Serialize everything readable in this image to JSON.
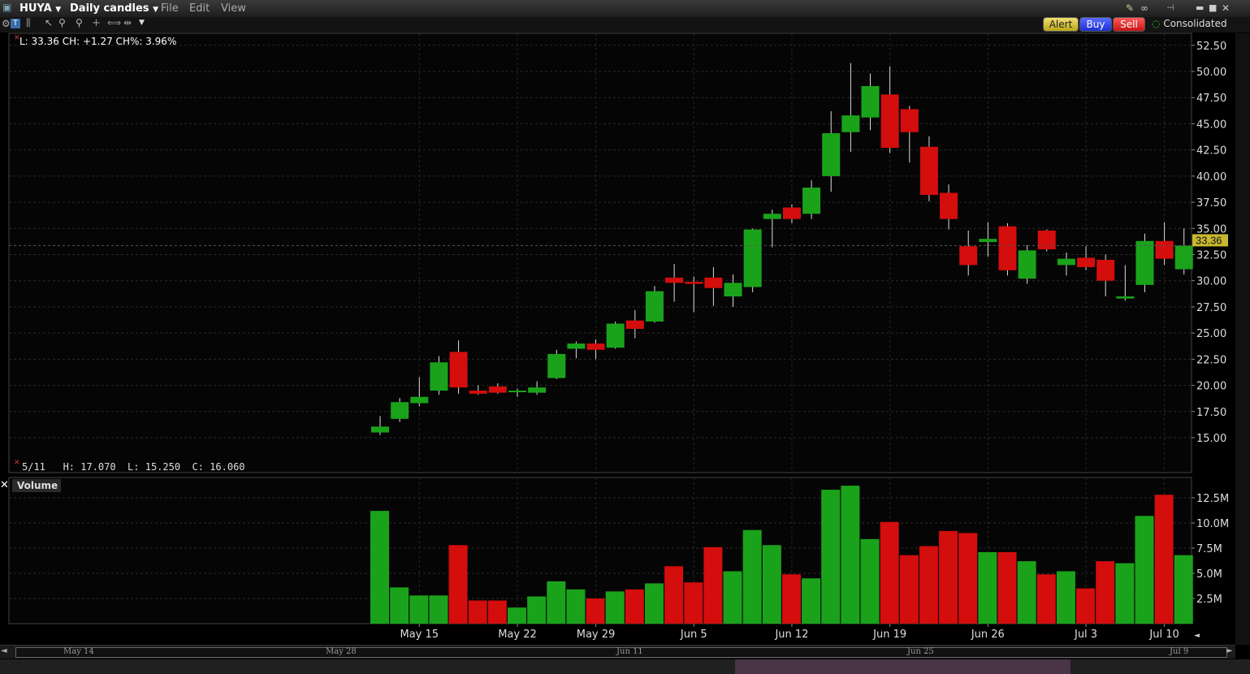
{
  "window": {
    "symbol": "HUYA",
    "chart_type": "Daily candles",
    "menu": [
      "File",
      "Edit",
      "View"
    ],
    "alert_label": "Alert",
    "buy_label": "Buy",
    "sell_label": "Sell",
    "consolidated_label": "Consolidated"
  },
  "info": {
    "top_line": "L: 33.36 CH: +1.27 CH%: 3.96%",
    "bottom_line": "5/11   H: 17.070  L: 15.250  C: 16.060",
    "last_price_badge": "33.36"
  },
  "volume_label": "Volume",
  "colors": {
    "up": "#1aa31a",
    "down": "#d40d0d",
    "badge": "#c8b830",
    "background": "#000000"
  },
  "scroll_labels": [
    "May 14",
    "May 28",
    "Jun 11",
    "Jun 25",
    "Jul 9"
  ],
  "chart_data": {
    "type": "candlestick",
    "price_ticks": [
      15.0,
      17.5,
      20.0,
      22.5,
      25.0,
      27.5,
      30.0,
      32.5,
      35.0,
      37.5,
      40.0,
      42.5,
      45.0,
      47.5,
      50.0,
      52.5
    ],
    "price_tick_labels": [
      "15.00",
      "17.50",
      "20.00",
      "22.50",
      "25.00",
      "27.50",
      "30.00",
      "32.50",
      "35.00",
      "37.50",
      "40.00",
      "42.50",
      "45.00",
      "47.50",
      "50.00",
      "52.50"
    ],
    "volume_ticks": [
      2.5,
      5.0,
      7.5,
      10.0,
      12.5
    ],
    "volume_tick_labels": [
      "2.5M",
      "5.0M",
      "7.5M",
      "10.0M",
      "12.5M"
    ],
    "x_labels": [
      "May 15",
      "May 22",
      "May 29",
      "Jun 5",
      "Jun 12",
      "Jun 19",
      "Jun 26",
      "Jul 3",
      "Jul 10"
    ],
    "x_label_dates": [
      "5/15",
      "5/22",
      "5/29",
      "6/5",
      "6/12",
      "6/19",
      "6/26",
      "7/3",
      "7/10"
    ],
    "candles": [
      {
        "d": "5/11",
        "o": 15.5,
        "h": 17.07,
        "l": 15.25,
        "c": 16.06,
        "v": 11.2
      },
      {
        "d": "5/14",
        "o": 16.8,
        "h": 18.8,
        "l": 16.5,
        "c": 18.4,
        "v": 3.6
      },
      {
        "d": "5/15",
        "o": 18.3,
        "h": 20.8,
        "l": 18.0,
        "c": 18.9,
        "v": 2.8
      },
      {
        "d": "5/16",
        "o": 19.5,
        "h": 22.8,
        "l": 19.1,
        "c": 22.2,
        "v": 2.8
      },
      {
        "d": "5/17",
        "o": 23.2,
        "h": 24.3,
        "l": 19.2,
        "c": 19.8,
        "v": 7.8
      },
      {
        "d": "5/18",
        "o": 19.5,
        "h": 20.0,
        "l": 19.1,
        "c": 19.2,
        "v": 2.3
      },
      {
        "d": "5/21",
        "o": 19.9,
        "h": 20.2,
        "l": 19.2,
        "c": 19.3,
        "v": 2.3
      },
      {
        "d": "5/22",
        "o": 19.4,
        "h": 19.7,
        "l": 18.9,
        "c": 19.5,
        "v": 1.6
      },
      {
        "d": "5/23",
        "o": 19.3,
        "h": 20.4,
        "l": 19.1,
        "c": 19.8,
        "v": 2.7
      },
      {
        "d": "5/24",
        "o": 20.7,
        "h": 23.4,
        "l": 20.6,
        "c": 23.0,
        "v": 4.2
      },
      {
        "d": "5/25",
        "o": 23.5,
        "h": 24.2,
        "l": 22.6,
        "c": 24.0,
        "v": 3.4
      },
      {
        "d": "5/29",
        "o": 24.0,
        "h": 24.4,
        "l": 22.5,
        "c": 23.4,
        "v": 2.5
      },
      {
        "d": "5/30",
        "o": 23.6,
        "h": 26.1,
        "l": 23.5,
        "c": 25.9,
        "v": 3.2
      },
      {
        "d": "5/31",
        "o": 26.2,
        "h": 27.2,
        "l": 24.5,
        "c": 25.4,
        "v": 3.4
      },
      {
        "d": "6/1",
        "o": 26.1,
        "h": 29.5,
        "l": 26.0,
        "c": 29.0,
        "v": 4.0
      },
      {
        "d": "6/4",
        "o": 30.3,
        "h": 31.6,
        "l": 28.0,
        "c": 29.8,
        "v": 5.7
      },
      {
        "d": "6/5",
        "o": 29.9,
        "h": 30.4,
        "l": 27.0,
        "c": 29.7,
        "v": 4.1
      },
      {
        "d": "6/6",
        "o": 30.3,
        "h": 31.3,
        "l": 27.6,
        "c": 29.3,
        "v": 7.6
      },
      {
        "d": "6/7",
        "o": 28.5,
        "h": 30.6,
        "l": 27.5,
        "c": 29.8,
        "v": 5.2
      },
      {
        "d": "6/8",
        "o": 29.4,
        "h": 35.0,
        "l": 28.9,
        "c": 34.9,
        "v": 9.3
      },
      {
        "d": "6/11",
        "o": 35.9,
        "h": 36.8,
        "l": 33.2,
        "c": 36.4,
        "v": 7.8
      },
      {
        "d": "6/12",
        "o": 37.0,
        "h": 37.3,
        "l": 35.5,
        "c": 35.9,
        "v": 4.9
      },
      {
        "d": "6/13",
        "o": 36.4,
        "h": 39.6,
        "l": 35.9,
        "c": 38.9,
        "v": 4.5
      },
      {
        "d": "6/14",
        "o": 40.0,
        "h": 46.2,
        "l": 38.5,
        "c": 44.1,
        "v": 13.3
      },
      {
        "d": "6/15",
        "o": 44.2,
        "h": 50.8,
        "l": 42.3,
        "c": 45.8,
        "v": 13.7
      },
      {
        "d": "6/18",
        "o": 45.6,
        "h": 49.8,
        "l": 44.4,
        "c": 48.6,
        "v": 8.4
      },
      {
        "d": "6/19",
        "o": 47.8,
        "h": 50.5,
        "l": 42.2,
        "c": 42.7,
        "v": 10.1
      },
      {
        "d": "6/20",
        "o": 46.4,
        "h": 46.7,
        "l": 41.3,
        "c": 44.2,
        "v": 6.8
      },
      {
        "d": "6/21",
        "o": 42.8,
        "h": 43.8,
        "l": 37.6,
        "c": 38.2,
        "v": 7.7
      },
      {
        "d": "6/22",
        "o": 38.4,
        "h": 39.2,
        "l": 34.9,
        "c": 35.9,
        "v": 9.2
      },
      {
        "d": "6/25",
        "o": 33.3,
        "h": 34.8,
        "l": 30.5,
        "c": 31.5,
        "v": 9.0
      },
      {
        "d": "6/26",
        "o": 33.7,
        "h": 35.6,
        "l": 32.3,
        "c": 34.0,
        "v": 7.1
      },
      {
        "d": "6/27",
        "o": 35.2,
        "h": 35.5,
        "l": 30.5,
        "c": 31.0,
        "v": 7.1
      },
      {
        "d": "6/28",
        "o": 30.2,
        "h": 33.4,
        "l": 29.7,
        "c": 32.9,
        "v": 6.2
      },
      {
        "d": "6/29",
        "o": 34.8,
        "h": 34.9,
        "l": 32.8,
        "c": 33.0,
        "v": 4.9
      },
      {
        "d": "7/2",
        "o": 31.5,
        "h": 32.7,
        "l": 30.5,
        "c": 32.1,
        "v": 5.2
      },
      {
        "d": "7/3",
        "o": 32.2,
        "h": 33.3,
        "l": 31.0,
        "c": 31.3,
        "v": 3.5
      },
      {
        "d": "7/5",
        "o": 32.0,
        "h": 32.5,
        "l": 28.5,
        "c": 30.0,
        "v": 6.2
      },
      {
        "d": "7/6",
        "o": 28.3,
        "h": 31.5,
        "l": 28.1,
        "c": 28.5,
        "v": 6.0
      },
      {
        "d": "7/9",
        "o": 29.6,
        "h": 34.5,
        "l": 28.9,
        "c": 33.8,
        "v": 10.7
      },
      {
        "d": "7/10",
        "o": 33.8,
        "h": 35.6,
        "l": 31.5,
        "c": 32.1,
        "v": 12.8
      },
      {
        "d": "7/11",
        "o": 31.1,
        "h": 35.0,
        "l": 30.6,
        "c": 33.36,
        "v": 6.8
      }
    ]
  }
}
